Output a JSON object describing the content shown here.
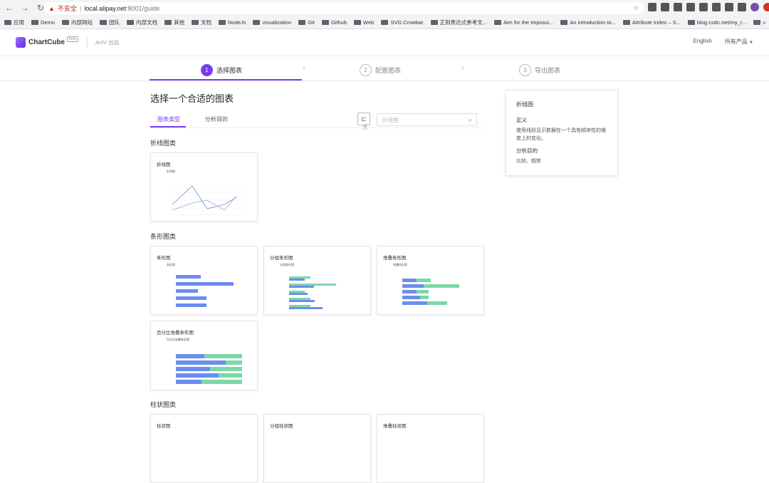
{
  "browser": {
    "insecure_label": "不安全",
    "url_host": "local.alipay.net",
    "url_path": ":8001/guide",
    "bookmarks": [
      "应用",
      "Demo",
      "内部网站",
      "团队",
      "内部文档",
      "其他",
      "文档",
      "NodeJs",
      "visualization",
      "Git",
      "Github",
      "Web",
      "SVG Crowbar",
      "正则表达式参考文...",
      "Aim for the Impossi...",
      "An introduction to...",
      "Attribute Index – S...",
      "blog.csdn.net/my_r...",
      "»",
      "其他书签"
    ]
  },
  "header": {
    "logo": "ChartCube",
    "beta": "beta",
    "by": "AntV 出品",
    "english": "English",
    "all_products": "所有产品"
  },
  "steps": [
    {
      "num": "1",
      "label": "选择图表"
    },
    {
      "num": "2",
      "label": "配置图表"
    },
    {
      "num": "3",
      "label": "导出图表"
    }
  ],
  "main": {
    "title": "选择一个合适的图表",
    "tab_type": "图表类型",
    "tab_purpose": "分析目的",
    "search_placeholder": "折线图"
  },
  "categories": {
    "line": "折线图类",
    "bar": "条形图类",
    "column": "柱状图类"
  },
  "cards": {
    "line": "折线图",
    "bar": "条形图",
    "grouped_bar": "分组条形图",
    "stacked_bar": "堆叠条形图",
    "percent_stacked_bar": "百分比堆叠条形图",
    "column": "柱状图",
    "grouped_column": "分组柱状图",
    "stacked_column": "堆叠柱状图"
  },
  "info": {
    "title": "折线图",
    "def_h": "定义",
    "def": "使用线段显示数据在一个具有顺序性的维度上的变化。",
    "purpose_h": "分析目的",
    "purpose": "比较、趋势"
  },
  "colors": {
    "accent": "#7a3cf0",
    "blue": "#6b8df0",
    "green": "#7dd8a8"
  }
}
